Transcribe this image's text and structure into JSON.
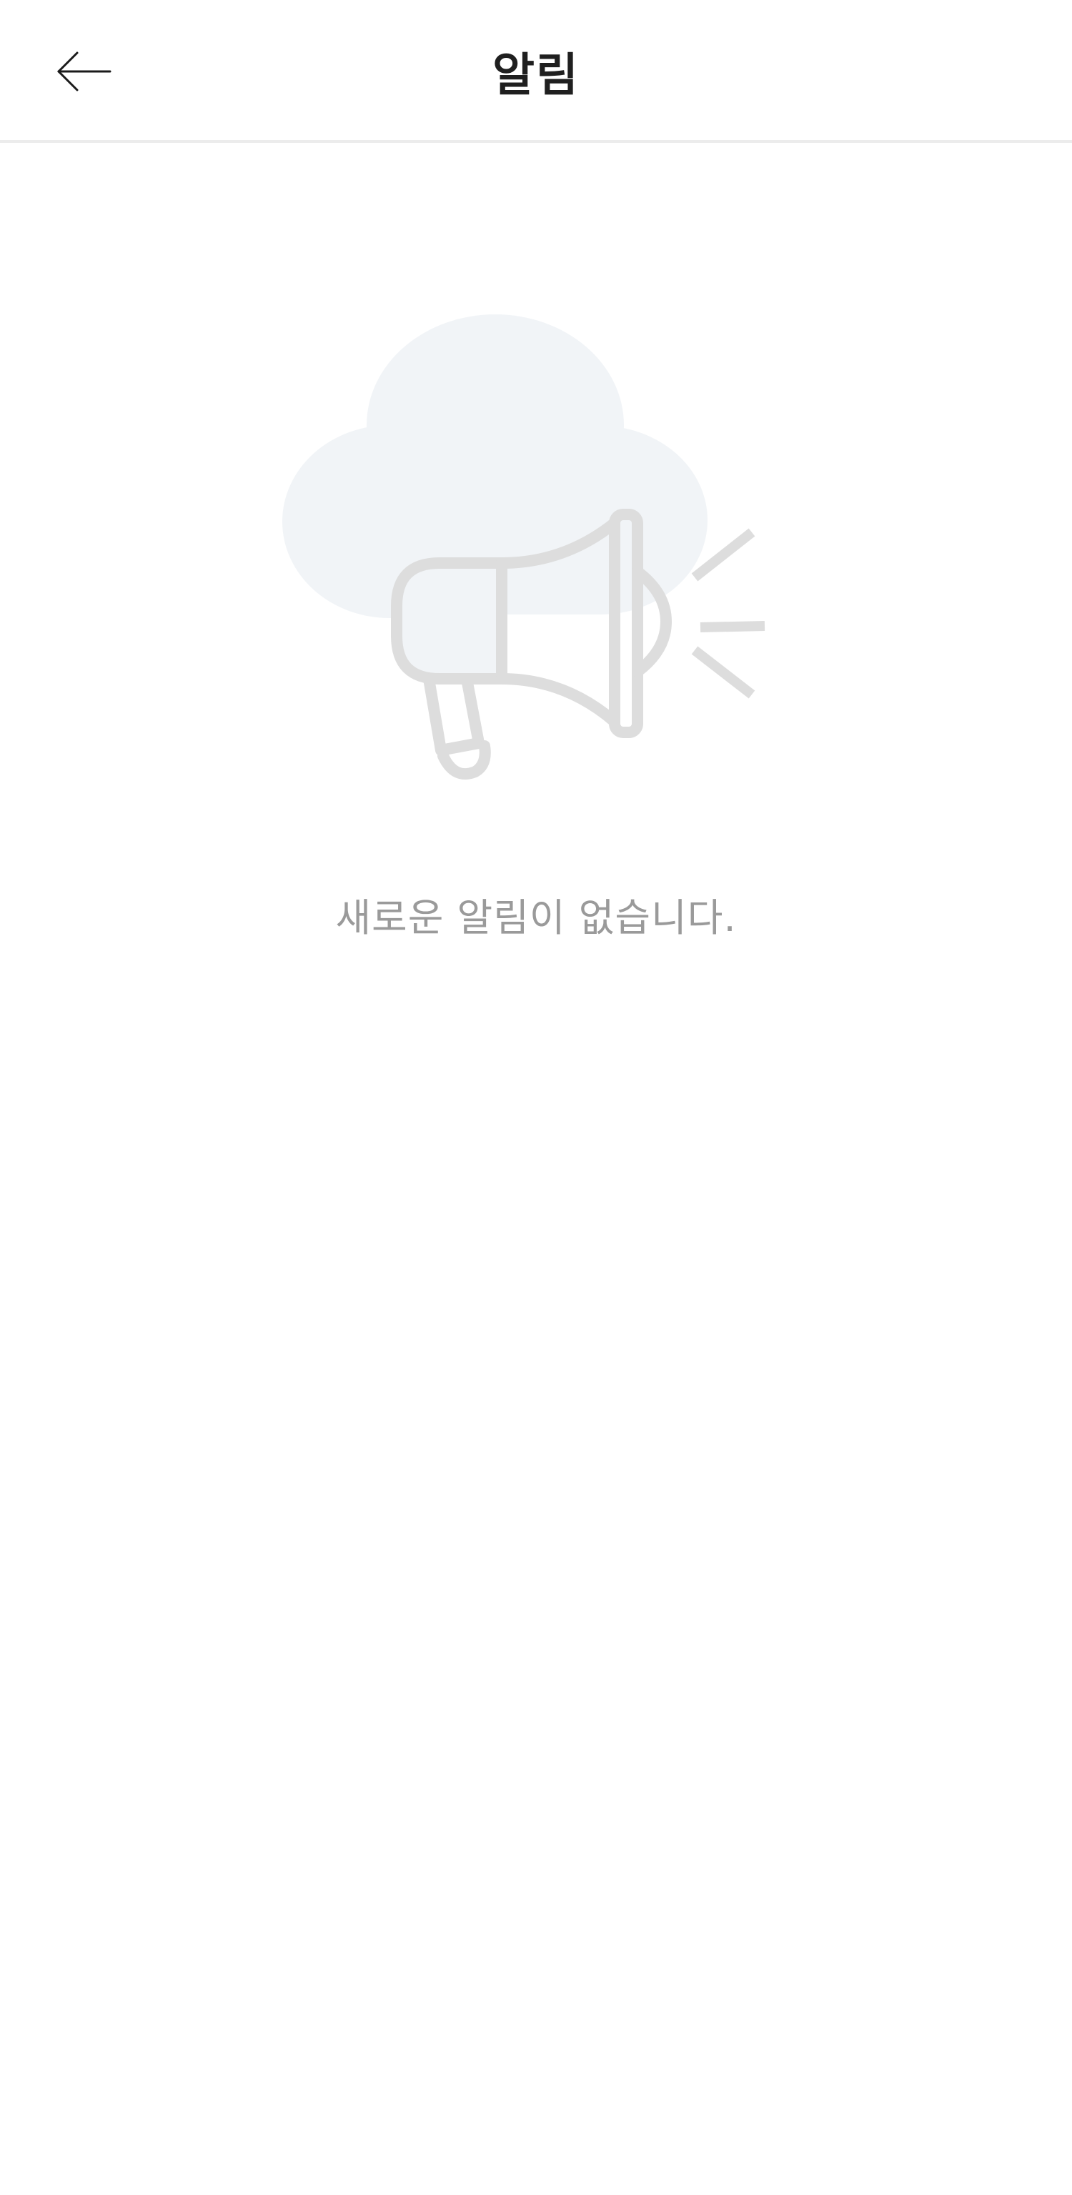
{
  "header": {
    "title": "알림",
    "back_icon": "arrow-left-icon"
  },
  "empty_state": {
    "illustration_icon": "megaphone-cloud-icon",
    "message": "새로운 알림이 없습니다."
  },
  "colors": {
    "title_text": "#1f1f1f",
    "message_text": "#9a9a9a",
    "illustration_stroke": "#dddddd",
    "cloud_fill": "#f1f4f7",
    "header_divider": "#ececec"
  }
}
